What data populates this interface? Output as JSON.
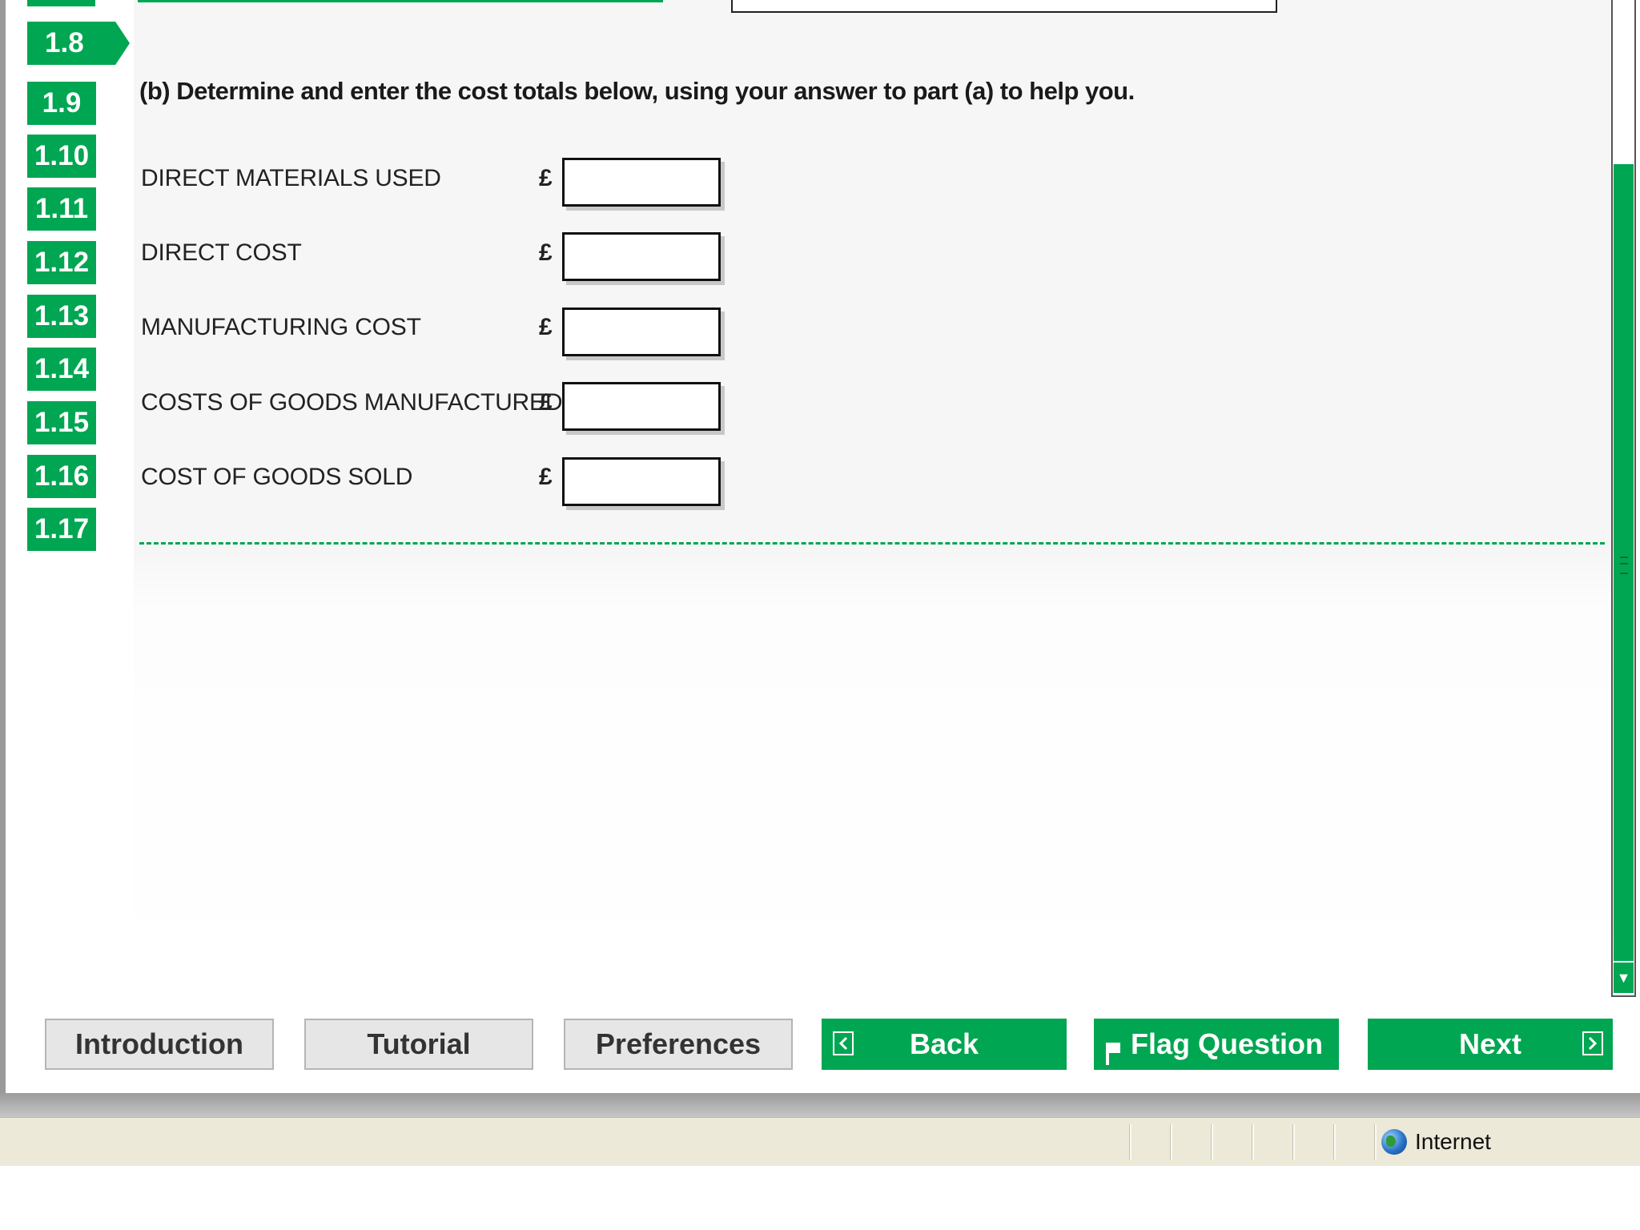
{
  "question_nav": {
    "items": [
      "1.8",
      "1.9",
      "1.10",
      "1.11",
      "1.12",
      "1.13",
      "1.14",
      "1.15",
      "1.16",
      "1.17"
    ],
    "active": "1.8"
  },
  "question": {
    "instruction": "(b) Determine and enter the cost totals below, using your answer to part (a) to help you.",
    "currency_symbol": "£",
    "rows": [
      {
        "label": "DIRECT MATERIALS USED",
        "value": ""
      },
      {
        "label": "DIRECT COST",
        "value": ""
      },
      {
        "label": "MANUFACTURING COST",
        "value": ""
      },
      {
        "label": "COSTS OF GOODS MANUFACTURED",
        "value": ""
      },
      {
        "label": "COST OF GOODS SOLD",
        "value": ""
      }
    ]
  },
  "toolbar": {
    "introduction": "Introduction",
    "tutorial": "Tutorial",
    "preferences": "Preferences",
    "back": "Back",
    "flag_question": "Flag Question",
    "next": "Next"
  },
  "status_bar": {
    "zone": "Internet"
  },
  "colors": {
    "accent_green": "#00a651",
    "button_gray": "#e6e6e6",
    "status_bar": "#ece9d8"
  }
}
